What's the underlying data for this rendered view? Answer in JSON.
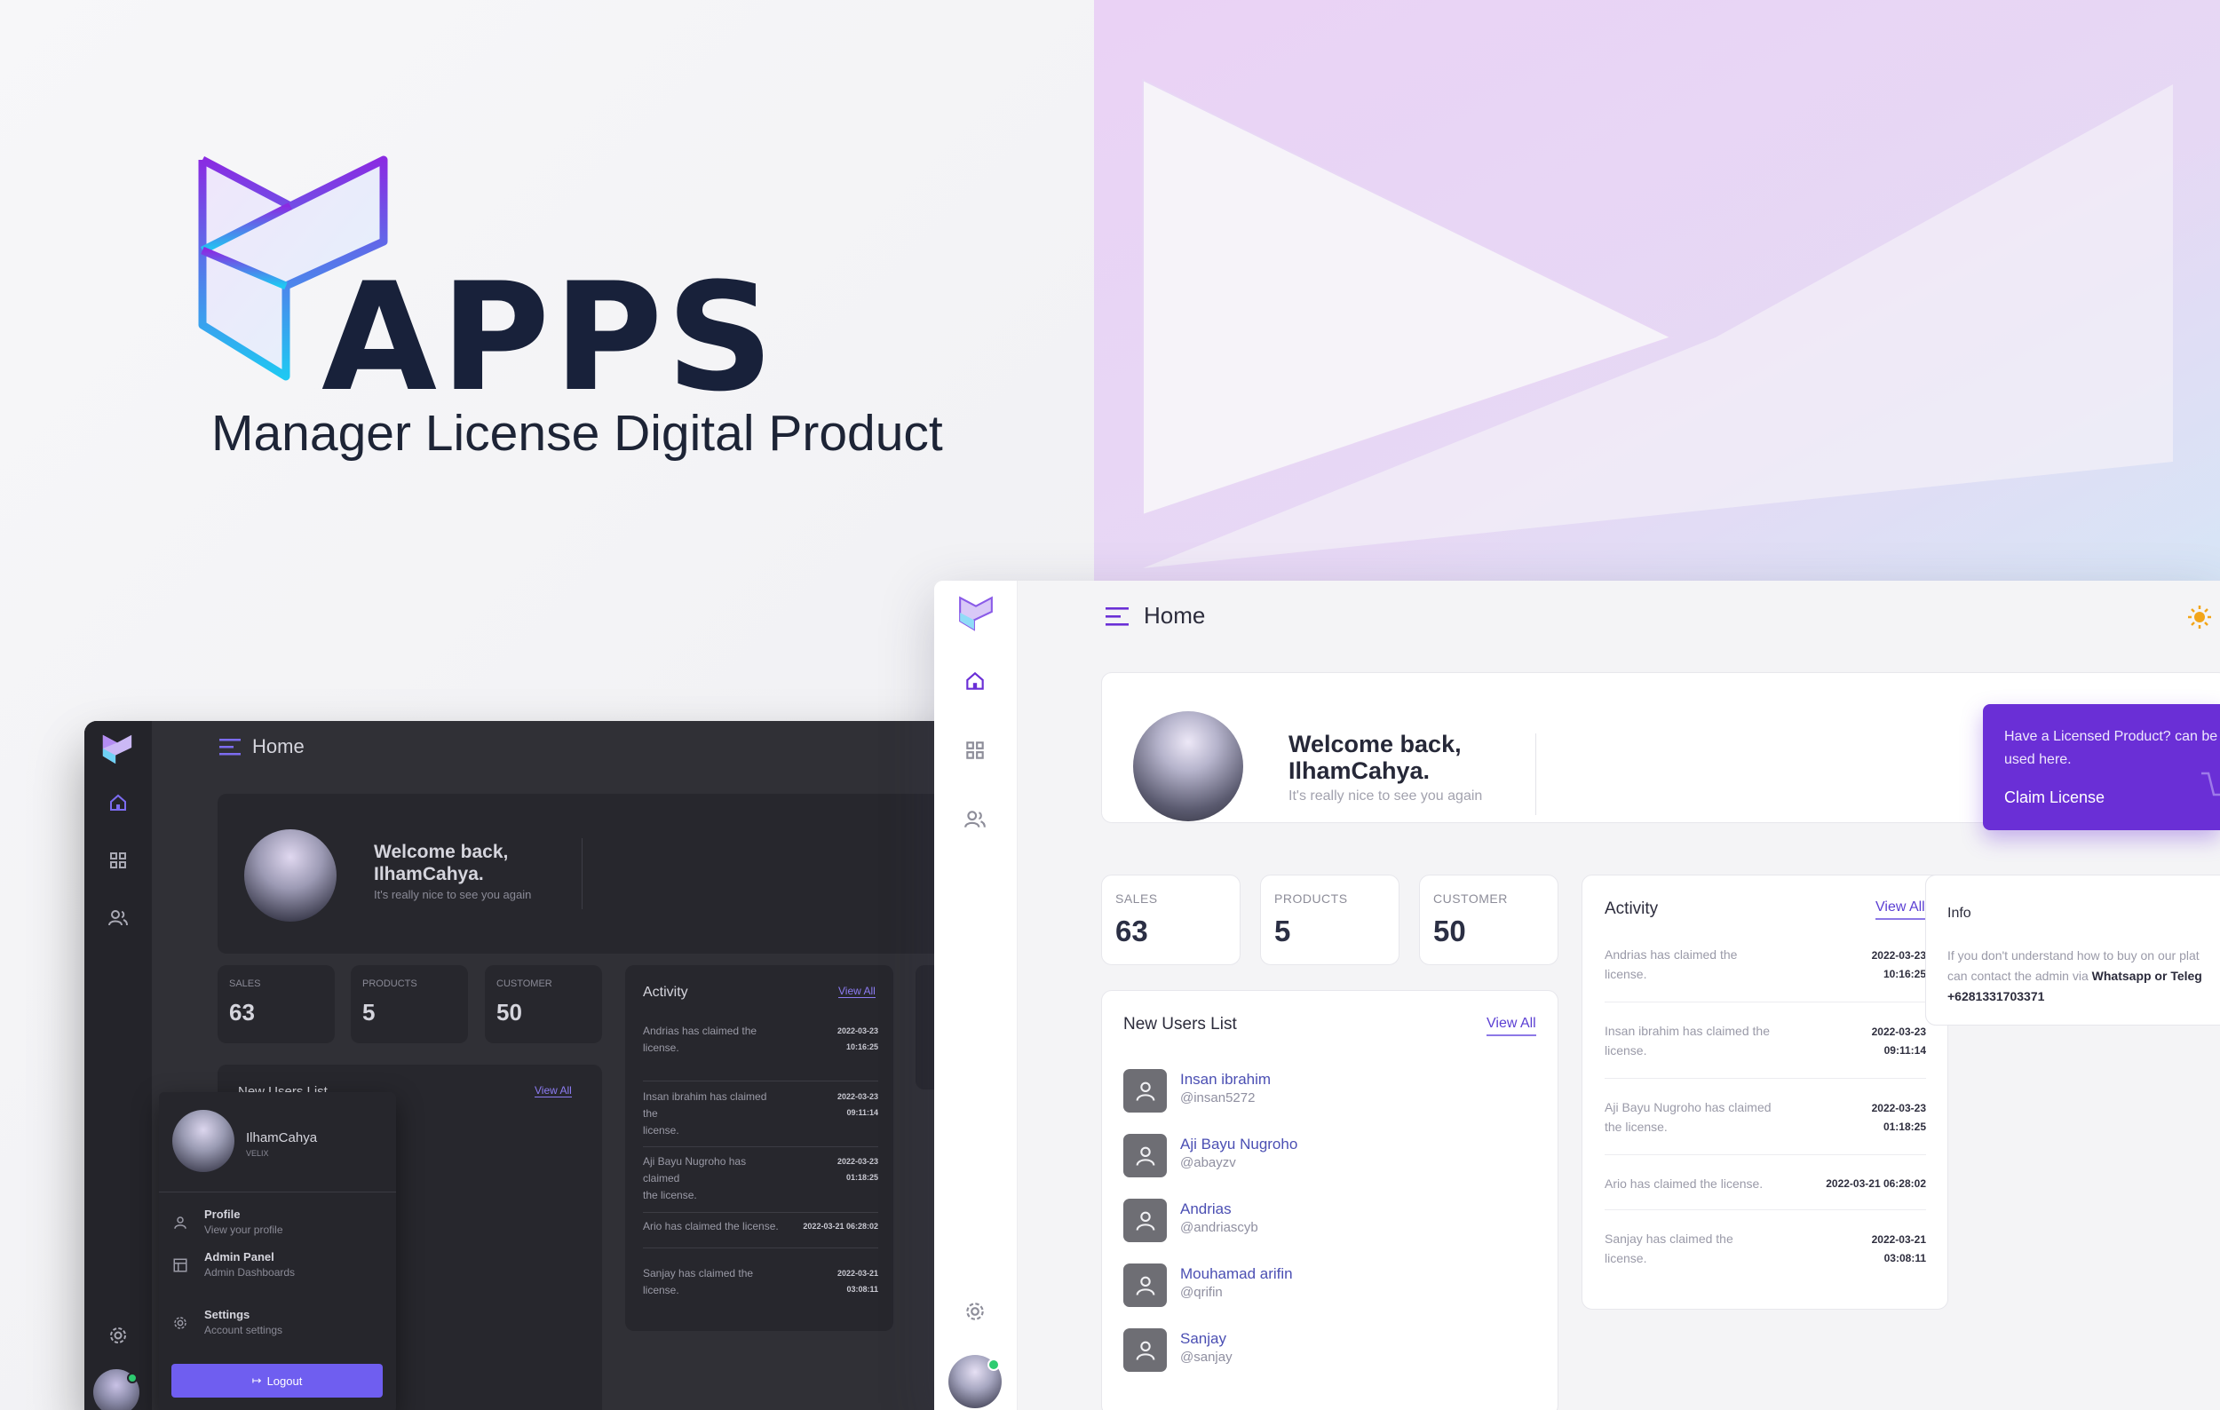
{
  "brand": {
    "word": "APPS",
    "tagline": "Manager License Digital Product"
  },
  "colors": {
    "accent": "#6a2fd6",
    "purple": "#7a3fe0",
    "cyan": "#27c6f2",
    "online": "#2ecc71",
    "sun": "#f2a51a"
  },
  "light": {
    "header": {
      "title": "Home"
    },
    "sidebar": {
      "icons": [
        "home-icon",
        "grid-icon",
        "users-icon",
        "settings-icon"
      ]
    },
    "welcome": {
      "line1": "Welcome back,",
      "line2": "IlhamCahya.",
      "sub": "It's really nice to see you again"
    },
    "promo": {
      "text1": "Have a Licensed Product? can be",
      "text2": "used here.",
      "button": "Claim License"
    },
    "stats": [
      {
        "label": "SALES",
        "value": "63"
      },
      {
        "label": "PRODUCTS",
        "value": "5"
      },
      {
        "label": "CUSTOMER",
        "value": "50"
      }
    ],
    "users": {
      "title": "New Users List",
      "view_all": "View All",
      "items": [
        {
          "name": "Insan ibrahim",
          "handle": "@insan5272"
        },
        {
          "name": "Aji Bayu Nugroho",
          "handle": "@abayzv"
        },
        {
          "name": "Andrias",
          "handle": "@andriascyb"
        },
        {
          "name": "Mouhamad arifin",
          "handle": "@qrifin"
        },
        {
          "name": "Sanjay",
          "handle": "@sanjay"
        }
      ]
    },
    "activity": {
      "title": "Activity",
      "view_all": "View All",
      "items": [
        {
          "l1": "Andrias has claimed the",
          "l2": "license.",
          "date": "2022-03-23",
          "time": "10:16:25"
        },
        {
          "l1": "Insan ibrahim has claimed the",
          "l2": "license.",
          "date": "2022-03-23",
          "time": "09:11:14"
        },
        {
          "l1": "Aji Bayu Nugroho has claimed",
          "l2": "the license.",
          "date": "2022-03-23",
          "time": "01:18:25"
        },
        {
          "l1": "Ario has claimed the license.",
          "l2": "",
          "date": "2022-03-21 06:28:02",
          "time": ""
        },
        {
          "l1": "Sanjay has claimed the",
          "l2": "license.",
          "date": "2022-03-21",
          "time": "03:08:11"
        }
      ]
    },
    "info": {
      "title": "Info",
      "line1": "If you don't understand how to buy on our plat",
      "line2_pre": "can contact the admin via ",
      "line2_bold": "Whatsapp or Teleg",
      "phone": "+6281331703371"
    }
  },
  "dark": {
    "header": {
      "title": "Home"
    },
    "welcome": {
      "line1": "Welcome back,",
      "line2": "IlhamCahya.",
      "sub": "It's really nice to see you again"
    },
    "stats": [
      {
        "label": "SALES",
        "value": "63"
      },
      {
        "label": "PRODUCTS",
        "value": "5"
      },
      {
        "label": "CUSTOMER",
        "value": "50"
      }
    ],
    "users_title": "New Users List",
    "users_view_all": "View All",
    "activity": {
      "title": "Activity",
      "view_all": "View All",
      "items": [
        {
          "l1": "Andrias has claimed the",
          "l2": "license.",
          "date": "2022-03-23",
          "time": "10:16:25"
        },
        {
          "l1": "Insan ibrahim has claimed the",
          "l2": "license.",
          "date": "2022-03-23",
          "time": "09:11:14"
        },
        {
          "l1": "Aji Bayu Nugroho has claimed",
          "l2": "the license.",
          "date": "2022-03-23",
          "time": "01:18:25"
        },
        {
          "l1": "Ario has claimed the license.",
          "l2": "",
          "date": "2022-03-21 06:28:02",
          "time": ""
        },
        {
          "l1": "Sanjay has claimed the",
          "l2": "license.",
          "date": "2022-03-21",
          "time": "03:08:11"
        }
      ]
    },
    "menu": {
      "user": "IlhamCahya",
      "role": "VELIX",
      "items": [
        {
          "title": "Profile",
          "sub": "View your profile",
          "icon": "user-icon"
        },
        {
          "title": "Admin Panel",
          "sub": "Admin Dashboards",
          "icon": "table-icon"
        },
        {
          "title": "Settings",
          "sub": "Account settings",
          "icon": "gear-icon"
        }
      ],
      "logout": "Logout"
    }
  }
}
